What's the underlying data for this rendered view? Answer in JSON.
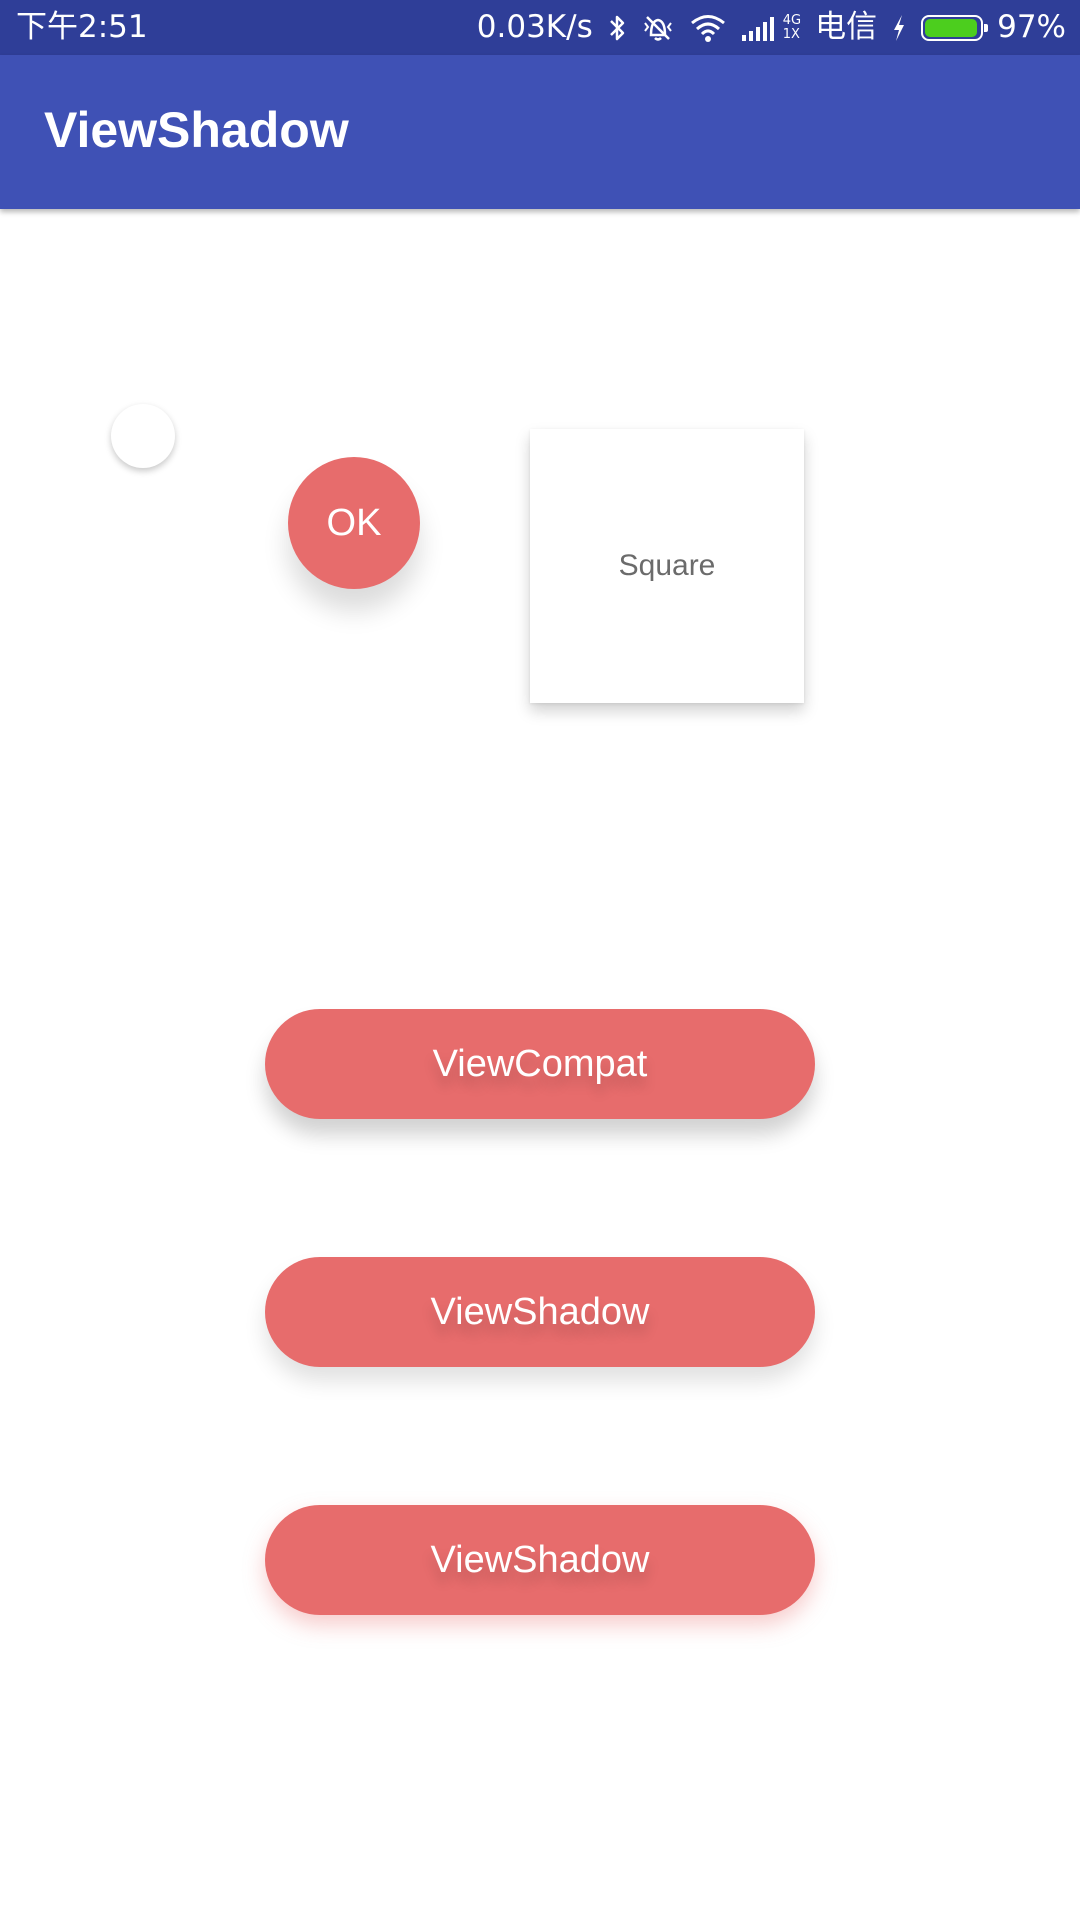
{
  "status_bar": {
    "time": "下午2:51",
    "network_speed": "0.03K/s",
    "network_type_top": "4G",
    "network_type_bottom": "1X",
    "carrier": "电信",
    "battery_percent": "97%",
    "battery_level": 0.97,
    "battery_color": "#4cce1e",
    "icons": [
      "bluetooth-icon",
      "vibrate-off-icon",
      "wifi-icon",
      "signal-icon",
      "charging-icon",
      "battery-icon"
    ]
  },
  "app_bar": {
    "title": "ViewShadow",
    "color": "#3f51b5"
  },
  "content": {
    "ok_button_label": "OK",
    "square_label": "Square",
    "accent_color": "#e76c6c",
    "buttons": [
      {
        "label": "ViewCompat"
      },
      {
        "label": "ViewShadow"
      },
      {
        "label": "ViewShadow"
      }
    ]
  }
}
